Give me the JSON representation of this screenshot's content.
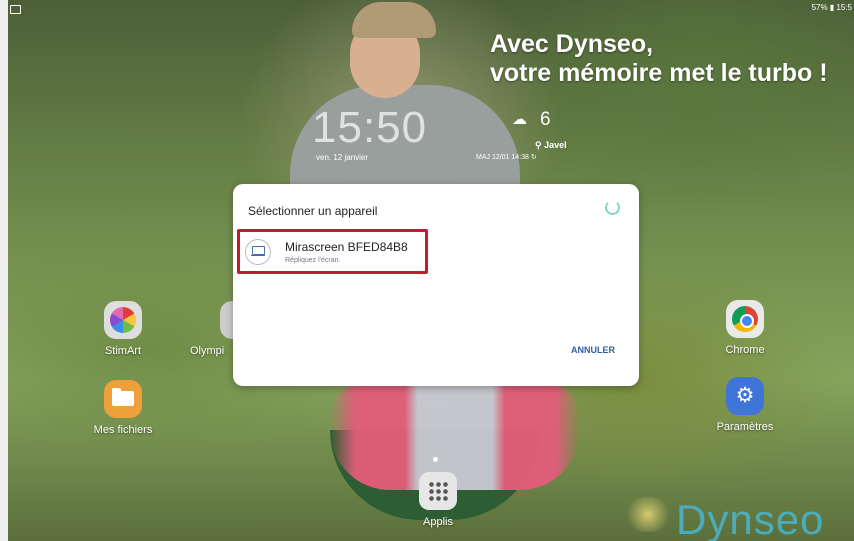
{
  "status_bar": {
    "right_text": "57% ▮ 15:5"
  },
  "promo": {
    "line1": "Avec Dynseo,",
    "line2": "votre mémoire met le turbo !"
  },
  "clock": {
    "time": "15:50",
    "date": "ven. 12 janvier"
  },
  "weather": {
    "temperature": "6",
    "city": "⚲ Javel",
    "updated": "MAJ 12/01 14:38 ↻"
  },
  "dialog": {
    "title": "Sélectionner un appareil",
    "device": {
      "name": "Mirascreen BFED84B8",
      "subtitle": "Répliquez l'écran."
    },
    "cancel_label": "ANNULER"
  },
  "apps": {
    "stimart": "StimArt",
    "olymp": "Olympi",
    "chrome": "Chrome",
    "files": "Mes fichiers",
    "settings": "Paramètres",
    "apps": "Applis"
  },
  "watermark": {
    "text": "Dynseo"
  },
  "colors": {
    "highlight": "#c6192b",
    "cancel_text": "#2f5fa6",
    "spinner": "#8ad3c9",
    "watermark": "#49b3c8"
  }
}
